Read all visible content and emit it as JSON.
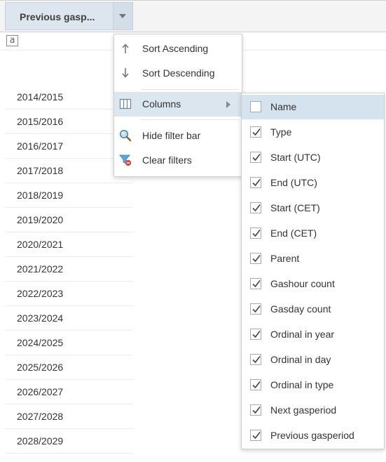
{
  "grid": {
    "header_title": "Previous gasp...",
    "filter_icon_glyph": "a",
    "rows": [
      "2014/2015",
      "2015/2016",
      "2016/2017",
      "2017/2018",
      "2018/2019",
      "2019/2020",
      "2020/2021",
      "2021/2022",
      "2022/2023",
      "2023/2024",
      "2024/2025",
      "2025/2026",
      "2026/2027",
      "2027/2028",
      "2028/2029"
    ]
  },
  "menu": {
    "sort_asc": "Sort Ascending",
    "sort_desc": "Sort Descending",
    "columns": "Columns",
    "hide_filter_bar": "Hide filter bar",
    "clear_filters": "Clear filters"
  },
  "columns_menu": [
    {
      "label": "Name",
      "checked": false
    },
    {
      "label": "Type",
      "checked": true
    },
    {
      "label": "Start (UTC)",
      "checked": true
    },
    {
      "label": "End (UTC)",
      "checked": true
    },
    {
      "label": "Start (CET)",
      "checked": true
    },
    {
      "label": "End (CET)",
      "checked": true
    },
    {
      "label": "Parent",
      "checked": true
    },
    {
      "label": "Gashour count",
      "checked": true
    },
    {
      "label": "Gasday count",
      "checked": true
    },
    {
      "label": "Ordinal in year",
      "checked": true
    },
    {
      "label": "Ordinal in day",
      "checked": true
    },
    {
      "label": "Ordinal in type",
      "checked": true
    },
    {
      "label": "Next gasperiod",
      "checked": true
    },
    {
      "label": "Previous gasperiod",
      "checked": true
    }
  ],
  "colors": {
    "header_bg": "#dde6ee",
    "menu_active_bg": "#dbe6ef",
    "submenu_active_bg": "#d5e3ee",
    "check_color": "#444444",
    "row_border": "#ededed"
  },
  "icons": {
    "sort_asc": "arrow-up-icon",
    "sort_desc": "arrow-down-icon",
    "columns": "columns-icon",
    "hide_filter_bar": "magnifier-icon",
    "clear_filters": "funnel-clear-icon",
    "submenu_arrow": "chevron-right-icon",
    "header_trigger": "chevron-down-icon",
    "checkbox_check": "checkmark-icon"
  }
}
